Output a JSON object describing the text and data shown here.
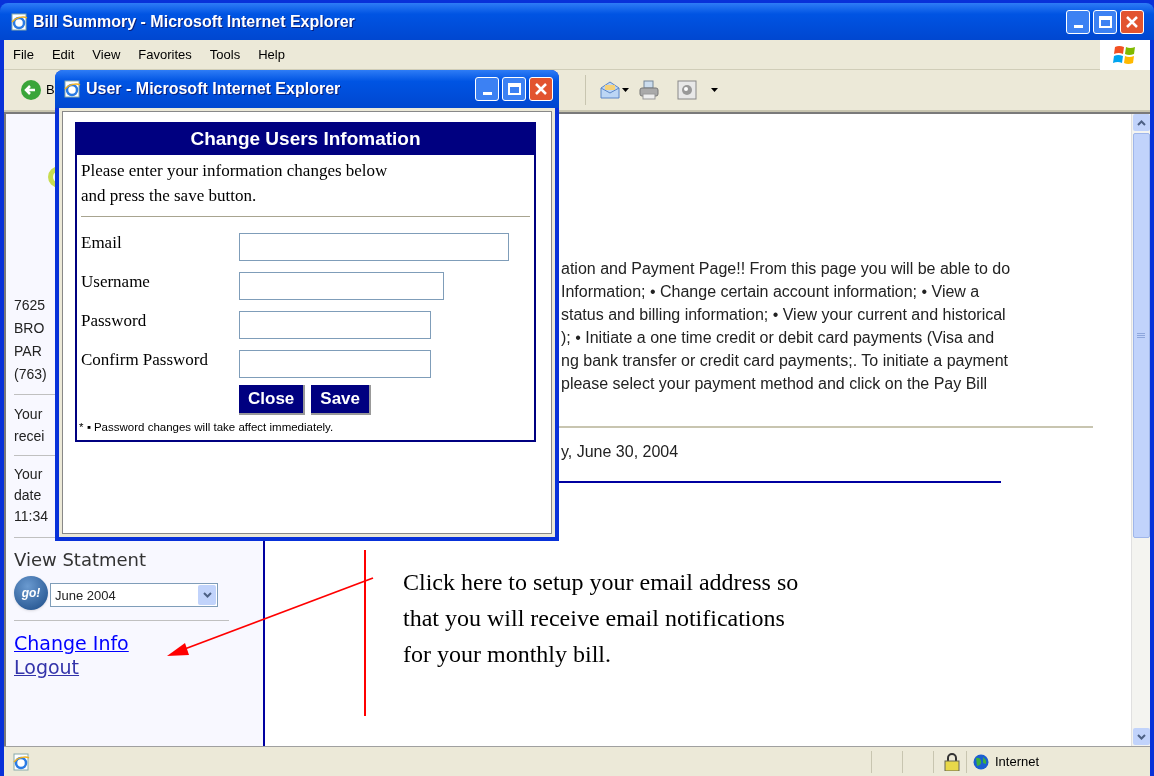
{
  "window": {
    "title": "Bill Summory - Microsoft Internet Explorer"
  },
  "menu": [
    "File",
    "Edit",
    "View",
    "Favorites",
    "Tools",
    "Help"
  ],
  "toolbar": {
    "back_label": "B"
  },
  "sidebar": {
    "address_lines": [
      "7625",
      "BRO",
      "PAR",
      "(763)"
    ],
    "notice_1": [
      "Your",
      "recei"
    ],
    "notice_2": [
      "Your",
      "date",
      "11:34"
    ],
    "statement_label": "View Statment",
    "go_label": "go!",
    "statement_select": "June 2004",
    "links": [
      "Change Info",
      "Logout"
    ]
  },
  "content": {
    "intro_lines": [
      "ation and Payment Page!! From this page you will be able to do",
      "Information; • Change certain account information; • View a",
      "status and billing information; • View your current and historical",
      "); • Initiate a one time credit or debit card payments (Visa and",
      "ng bank transfer or credit card payments;. To initiate a payment",
      "please select your payment method and click on the Pay Bill"
    ],
    "date_line": "y, June 30, 2004"
  },
  "annotation": {
    "lines": [
      "Click here to setup your email address so",
      "that you will receive email notifications",
      "for your monthly bill."
    ]
  },
  "popup": {
    "title": "User - Microsoft Internet Explorer",
    "heading": "Change Users Infomation",
    "instructions": [
      "Please enter your information changes below",
      "and press the save button."
    ],
    "fields": [
      {
        "label": "Email"
      },
      {
        "label": "Username"
      },
      {
        "label": "Password"
      },
      {
        "label": "Confirm Password"
      }
    ],
    "buttons": [
      "Close",
      "Save"
    ],
    "note": "* ▪ Password changes will take affect immediately."
  },
  "status_bar": {
    "zone": "Internet"
  }
}
